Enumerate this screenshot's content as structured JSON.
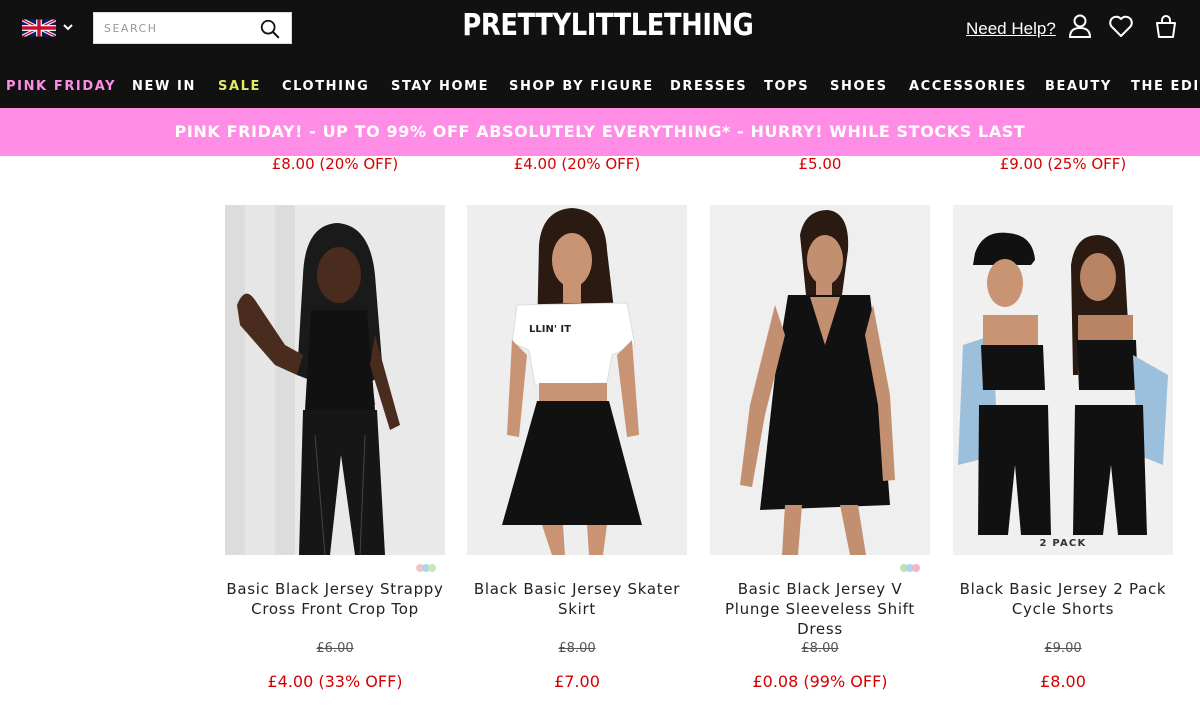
{
  "header": {
    "search_placeholder": "SEARCH",
    "logo": "PRETTYLITTLETHING",
    "help_label": "Need Help?",
    "icons": [
      "uk-flag-icon",
      "chevron-down-icon",
      "search-icon",
      "user-icon",
      "heart-icon",
      "bag-icon"
    ]
  },
  "nav": {
    "items": [
      {
        "label": "PINK FRIDAY",
        "color": "#ff8de5"
      },
      {
        "label": "NEW IN",
        "color": "#ffffff"
      },
      {
        "label": "SALE",
        "color": "#e6e86a"
      },
      {
        "label": "CLOTHING",
        "color": "#ffffff"
      },
      {
        "label": "STAY HOME",
        "color": "#ffffff"
      },
      {
        "label": "SHOP BY FIGURE",
        "color": "#ffffff"
      },
      {
        "label": "DRESSES",
        "color": "#ffffff"
      },
      {
        "label": "TOPS",
        "color": "#ffffff"
      },
      {
        "label": "SHOES",
        "color": "#ffffff"
      },
      {
        "label": "ACCESSORIES",
        "color": "#ffffff"
      },
      {
        "label": "BEAUTY",
        "color": "#ffffff"
      },
      {
        "label": "THE EDIT",
        "color": "#ffffff"
      }
    ]
  },
  "banner": {
    "text": "PINK FRIDAY! - UP TO 99% OFF ABSOLUTELY EVERYTHING* - HURRY! WHILE STOCKS LAST",
    "color": "#ff8de5"
  },
  "previous_row_prices": [
    "£8.00 (20% OFF)",
    "£4.00 (20% OFF)",
    "£5.00",
    "£9.00 (25% OFF)"
  ],
  "products": [
    {
      "name_line1": "Basic Black Jersey Strappy",
      "name_line2": "Cross Front Crop Top",
      "name_line3": "",
      "old_price": "£6.00",
      "price": "£4.00 (33% OFF)",
      "badge": ""
    },
    {
      "name_line1": "Black Basic Jersey Skater",
      "name_line2": "Skirt",
      "name_line3": "",
      "old_price": "£8.00",
      "price": "£7.00",
      "badge": ""
    },
    {
      "name_line1": "Basic Black Jersey V",
      "name_line2": "Plunge Sleeveless Shift",
      "name_line3": "Dress",
      "old_price": "£8.00",
      "price": "£0.08 (99% OFF)",
      "badge": ""
    },
    {
      "name_line1": "Black Basic Jersey 2 Pack",
      "name_line2": "Cycle Shorts",
      "name_line3": "",
      "old_price": "£9.00",
      "price": "£8.00",
      "badge": "2 PACK"
    }
  ],
  "tshirt_print": "LLIN' IT"
}
